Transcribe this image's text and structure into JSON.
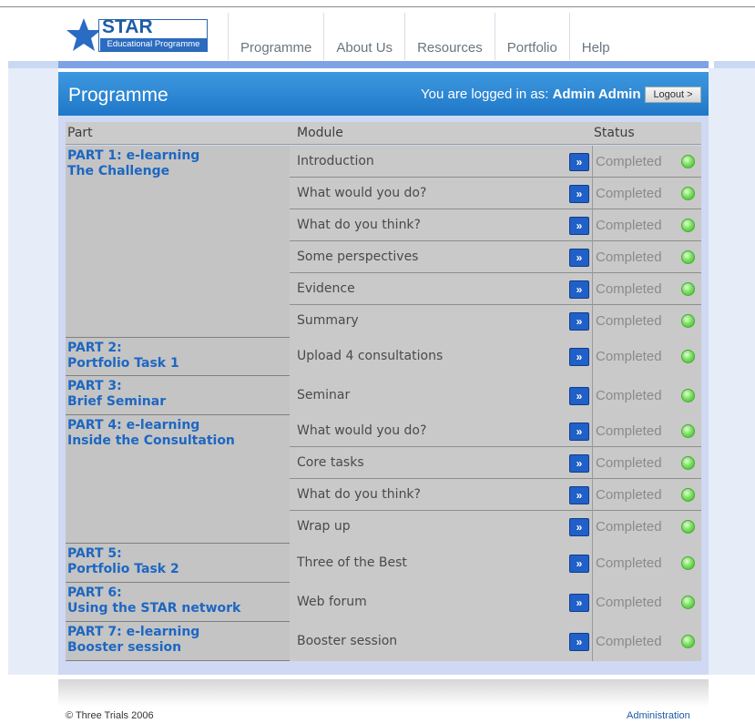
{
  "logo": {
    "title": "STAR",
    "subtitle": "Educational Programme"
  },
  "nav": [
    "Programme",
    "About Us",
    "Resources",
    "Portfolio",
    "Help"
  ],
  "page": {
    "title": "Programme",
    "login_prefix": "You are logged in as:",
    "user": "Admin Admin",
    "logout_label": "Logout >"
  },
  "table": {
    "headers": {
      "part": "Part",
      "module": "Module",
      "status": "Status"
    },
    "groups": [
      {
        "part": [
          "PART 1: e-learning",
          "The Challenge"
        ],
        "modules": [
          "Introduction",
          "What would you do?",
          "What do you think?",
          "Some perspectives",
          "Evidence",
          "Summary"
        ]
      },
      {
        "part": [
          "PART 2:",
          "Portfolio Task 1"
        ],
        "modules": [
          "Upload 4 consultations"
        ]
      },
      {
        "part": [
          "PART 3:",
          "Brief Seminar"
        ],
        "modules": [
          "Seminar"
        ]
      },
      {
        "part": [
          "PART 4: e-learning",
          "Inside the Consultation"
        ],
        "modules": [
          "What would you do?",
          "Core tasks",
          "What do you think?",
          "Wrap up"
        ]
      },
      {
        "part": [
          "PART 5:",
          "Portfolio Task 2"
        ],
        "modules": [
          "Three of the Best"
        ]
      },
      {
        "part": [
          "PART 6:",
          "Using the STAR network"
        ],
        "modules": [
          "Web forum"
        ]
      },
      {
        "part": [
          "PART 7: e-learning",
          "Booster session"
        ],
        "modules": [
          "Booster session"
        ]
      }
    ],
    "status_label": "Completed",
    "go_glyph": "»",
    "status_color": "#5ccf45"
  },
  "footer": {
    "copyright": "© Three Trials 2006",
    "admin_link": "Administration"
  }
}
